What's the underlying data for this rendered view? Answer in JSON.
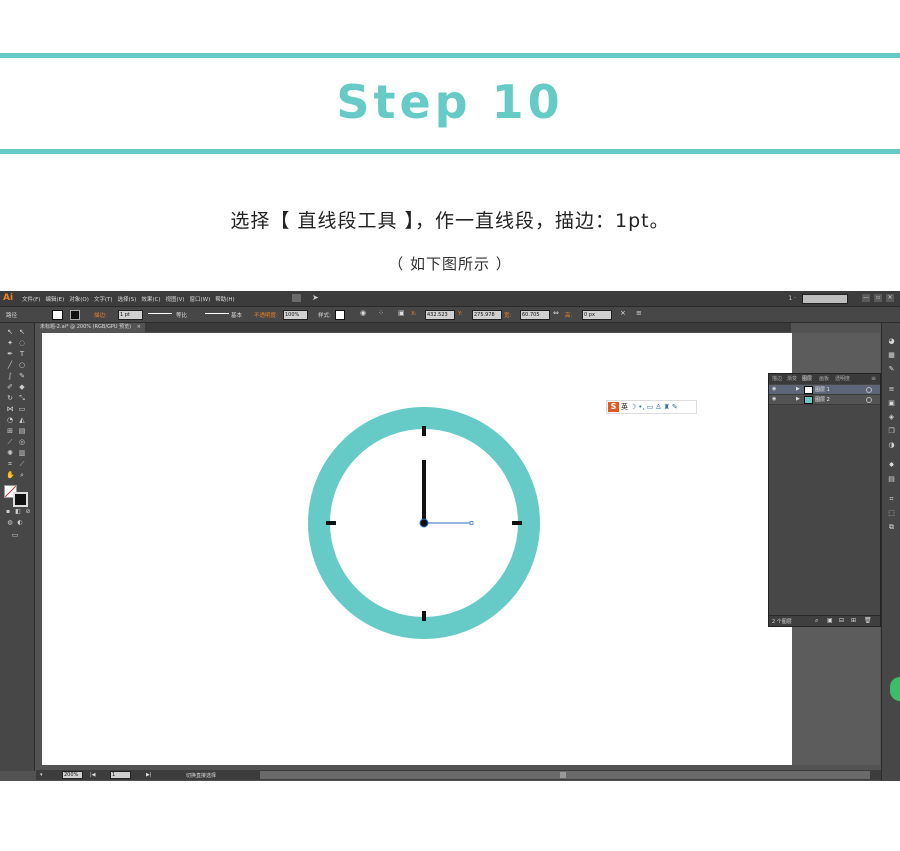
{
  "header": {
    "title": "Step 10",
    "instruction": "选择【 直线段工具 】，作一直线段，描边：1pt。",
    "sub_note": "（ 如下图所示 ）"
  },
  "colors": {
    "accent": "#66cbc6",
    "clock_hands": "#111111",
    "line_selection": "#2f6fbf",
    "ui_dark": "#535353"
  },
  "app": {
    "logo": "Ai",
    "menus": [
      "文件(F)",
      "编辑(E)",
      "对象(O)",
      "文字(T)",
      "选择(S)",
      "效果(C)",
      "视图(V)",
      "窗口(W)",
      "帮助(H)"
    ],
    "page_indicator": "1 ·",
    "window_controls": [
      "—",
      "▫",
      "✕"
    ]
  },
  "control_bar": {
    "mode_label": "路径",
    "stroke_label": "描边:",
    "stroke_weight": "1 pt",
    "profile_label": "等比",
    "brush_label": "基本",
    "opacity_label": "不透明度:",
    "opacity_value": "100%",
    "style_label": "样式:",
    "x_label": "X:",
    "x_value": "432.523",
    "y_label": "Y:",
    "y_value": "275.978",
    "w_label": "宽:",
    "w_value": "60.705",
    "h_label": "高:",
    "h_value": "0 px"
  },
  "document": {
    "tab_label": "未标题-2.ai* @ 200% (RGB/GPU 预览)",
    "tab_close": "×",
    "zoom": "200%",
    "artboard_num": "1",
    "status_text": "切换直接选择"
  },
  "layers_panel": {
    "tabs": [
      "描边",
      "渐变",
      "图层",
      "画板",
      "透明度"
    ],
    "active_tab": "图层",
    "layers": [
      {
        "name": "图层 1",
        "selected": true
      },
      {
        "name": "图层 2",
        "selected": false
      }
    ],
    "count_text": "2 个图层"
  },
  "ime_bar": {
    "logo": "S",
    "mode": "英"
  }
}
